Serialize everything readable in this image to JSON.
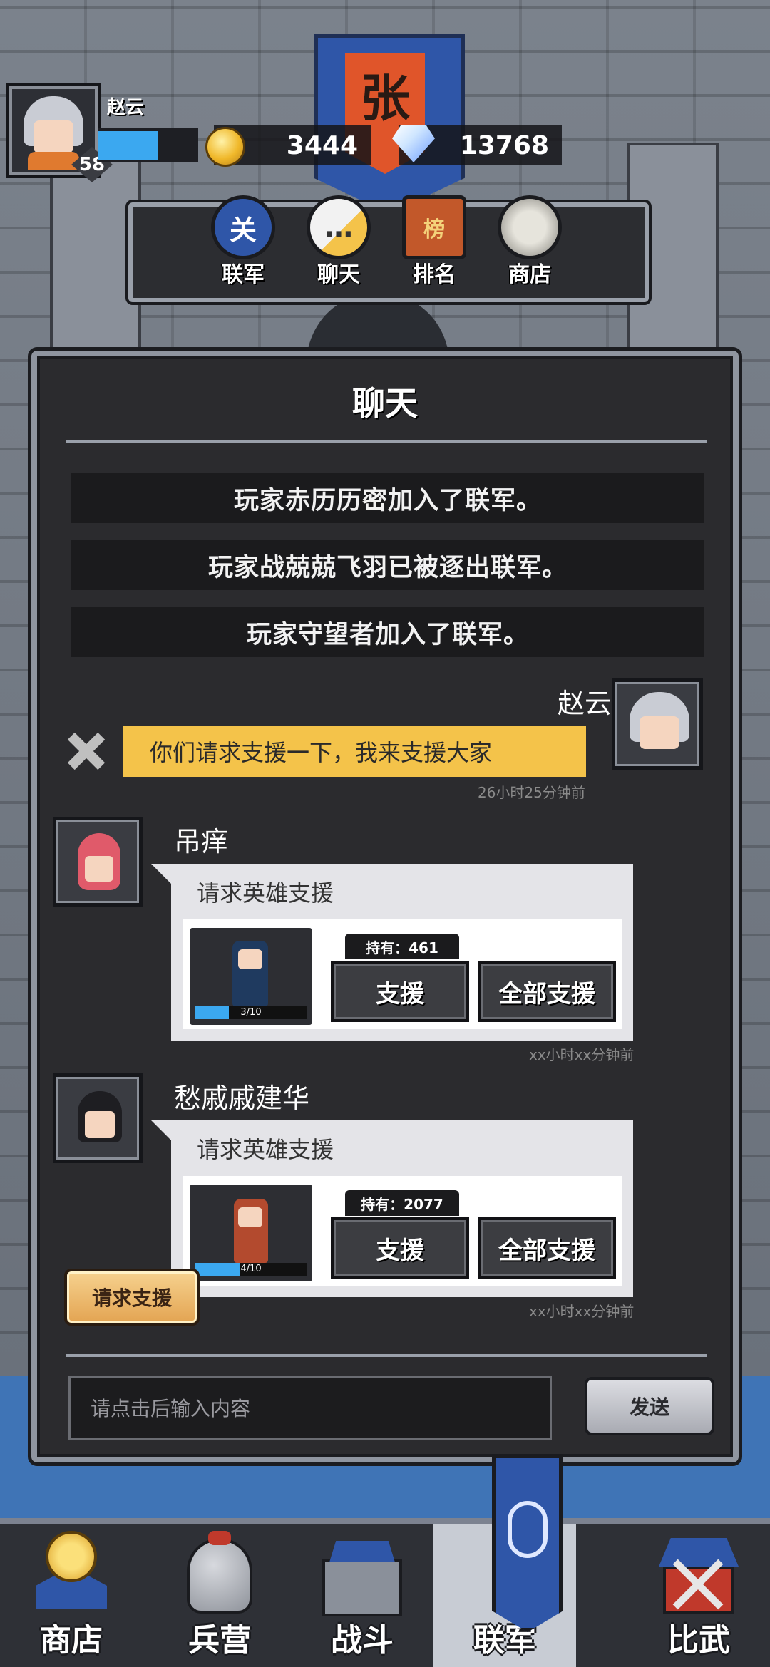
{
  "banner": {
    "char": "张"
  },
  "player": {
    "name": "赵云",
    "level": "58",
    "exp_fraction": 0.6
  },
  "currency": {
    "gold": "3444",
    "diamond": "13768"
  },
  "top_menu": [
    {
      "label": "联军",
      "icon": "alliance-shield-icon",
      "glyph": "关"
    },
    {
      "label": "聊天",
      "icon": "chat-bubble-icon",
      "glyph": "…"
    },
    {
      "label": "排名",
      "icon": "ranking-banner-icon",
      "glyph": "榜"
    },
    {
      "label": "商店",
      "icon": "shop-coin-icon",
      "glyph": ""
    }
  ],
  "chat": {
    "title": "聊天",
    "system_messages": [
      "玩家赤历历密加入了联军。",
      "玩家战兢兢飞羽已被逐出联军。",
      "玩家守望者加入了联军。"
    ],
    "self_message": {
      "name": "赵云",
      "text": "你们请求支援一下，我来支援大家",
      "time": "26小时25分钟前"
    },
    "requests": [
      {
        "name": "吊痒",
        "title": "请求英雄支援",
        "hold": "持有：461",
        "progress": "3/10",
        "progress_fraction": 0.3,
        "support": "支援",
        "support_all": "全部支援",
        "time": "xx小时xx分钟前"
      },
      {
        "name": "愁戚戚建华",
        "title": "请求英雄支援",
        "hold": "持有：2077",
        "progress": "4/10",
        "progress_fraction": 0.4,
        "support": "支援",
        "support_all": "全部支援",
        "time": "xx小时xx分钟前"
      }
    ],
    "request_support_button": "请求支援",
    "input_placeholder": "请点击后输入内容",
    "send_button": "发送"
  },
  "bottom_nav": [
    {
      "label": "商店",
      "icon": "shop-coin-icon"
    },
    {
      "label": "兵营",
      "icon": "barracks-helmet-icon"
    },
    {
      "label": "战斗",
      "icon": "battle-castle-icon"
    },
    {
      "label": "联军",
      "icon": "alliance-dragon-banner-icon",
      "active": true
    },
    {
      "label": "比武",
      "icon": "arena-swords-icon"
    }
  ],
  "colors": {
    "accent_blue": "#3ba8f0",
    "bubble_yellow": "#f4c34a",
    "panel_bg": "#2b2b2e",
    "request_gold": "#e3a452"
  }
}
